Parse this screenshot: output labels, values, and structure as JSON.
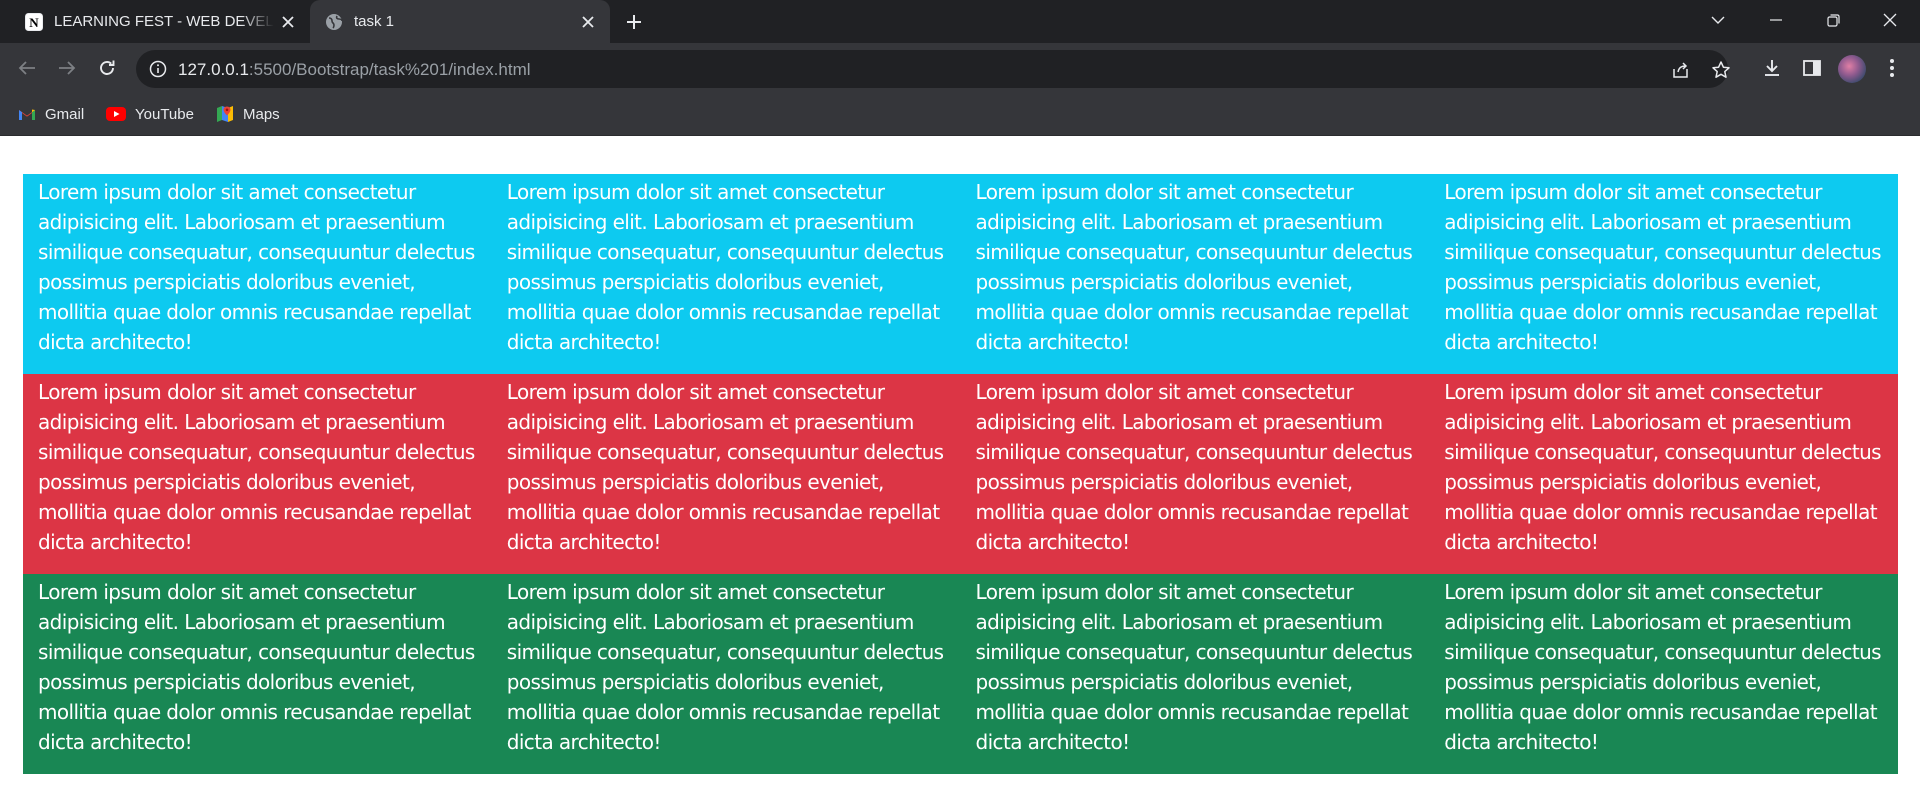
{
  "browser": {
    "tabs": [
      {
        "title": "LEARNING FEST - WEB DEVELOPMENT",
        "favicon": "notion-icon"
      },
      {
        "title": "task 1",
        "favicon": "globe-icon"
      }
    ],
    "address": {
      "host": "127.0.0.1",
      "path": ":5500/Bootstrap/task%201/index.html"
    },
    "bookmarks": [
      {
        "label": "Gmail",
        "icon": "gmail-icon"
      },
      {
        "label": "YouTube",
        "icon": "youtube-icon"
      },
      {
        "label": "Maps",
        "icon": "maps-icon"
      }
    ]
  },
  "page": {
    "rows": [
      {
        "color": "#0dcaf0",
        "cells": [
          "Lorem ipsum dolor sit amet consectetur adipisicing elit. Laboriosam et praesentium similique consequatur, consequuntur delectus possimus perspiciatis doloribus eveniet, mollitia quae dolor omnis recusandae repellat dicta architecto!",
          "Lorem ipsum dolor sit amet consectetur adipisicing elit. Laboriosam et praesentium similique consequatur, consequuntur delectus possimus perspiciatis doloribus eveniet, mollitia quae dolor omnis recusandae repellat dicta architecto!",
          "Lorem ipsum dolor sit amet consectetur adipisicing elit. Laboriosam et praesentium similique consequatur, consequuntur delectus possimus perspiciatis doloribus eveniet, mollitia quae dolor omnis recusandae repellat dicta architecto!",
          "Lorem ipsum dolor sit amet consectetur adipisicing elit. Laboriosam et praesentium similique consequatur, consequuntur delectus possimus perspiciatis doloribus eveniet, mollitia quae dolor omnis recusandae repellat dicta architecto!"
        ]
      },
      {
        "color": "#dc3545",
        "cells": [
          "Lorem ipsum dolor sit amet consectetur adipisicing elit. Laboriosam et praesentium similique consequatur, consequuntur delectus possimus perspiciatis doloribus eveniet, mollitia quae dolor omnis recusandae repellat dicta architecto!",
          "Lorem ipsum dolor sit amet consectetur adipisicing elit. Laboriosam et praesentium similique consequatur, consequuntur delectus possimus perspiciatis doloribus eveniet, mollitia quae dolor omnis recusandae repellat dicta architecto!",
          "Lorem ipsum dolor sit amet consectetur adipisicing elit. Laboriosam et praesentium similique consequatur, consequuntur delectus possimus perspiciatis doloribus eveniet, mollitia quae dolor omnis recusandae repellat dicta architecto!",
          "Lorem ipsum dolor sit amet consectetur adipisicing elit. Laboriosam et praesentium similique consequatur, consequuntur delectus possimus perspiciatis doloribus eveniet, mollitia quae dolor omnis recusandae repellat dicta architecto!"
        ]
      },
      {
        "color": "#198754",
        "cells": [
          "Lorem ipsum dolor sit amet consectetur adipisicing elit. Laboriosam et praesentium similique consequatur, consequuntur delectus possimus perspiciatis doloribus eveniet, mollitia quae dolor omnis recusandae repellat dicta architecto!",
          "Lorem ipsum dolor sit amet consectetur adipisicing elit. Laboriosam et praesentium similique consequatur, consequuntur delectus possimus perspiciatis doloribus eveniet, mollitia quae dolor omnis recusandae repellat dicta architecto!",
          "Lorem ipsum dolor sit amet consectetur adipisicing elit. Laboriosam et praesentium similique consequatur, consequuntur delectus possimus perspiciatis doloribus eveniet, mollitia quae dolor omnis recusandae repellat dicta architecto!",
          "Lorem ipsum dolor sit amet consectetur adipisicing elit. Laboriosam et praesentium similique consequatur, consequuntur delectus possimus perspiciatis doloribus eveniet, mollitia quae dolor omnis recusandae repellat dicta architecto!"
        ]
      }
    ]
  }
}
